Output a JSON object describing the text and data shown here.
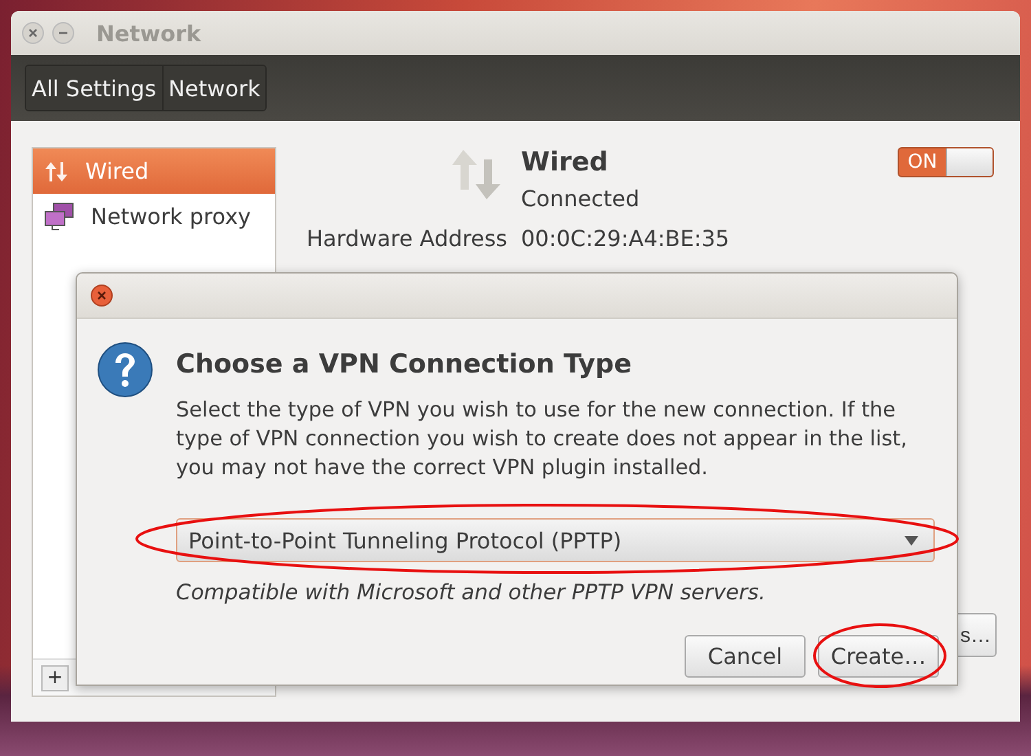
{
  "window": {
    "title": "Network"
  },
  "breadcrumbs": [
    {
      "label": "All Settings"
    },
    {
      "label": "Network"
    }
  ],
  "sidebar": {
    "items": [
      {
        "label": "Wired",
        "kind": "wired",
        "selected": true
      },
      {
        "label": "Network proxy",
        "kind": "proxy",
        "selected": false
      }
    ],
    "buttons": [
      "+"
    ]
  },
  "device": {
    "name": "Wired",
    "status": "Connected",
    "switch": {
      "label": "ON",
      "on": true
    },
    "details": [
      {
        "label": "Hardware Address",
        "value": "00:0C:29:A4:BE:35"
      }
    ],
    "partial_button": "s…"
  },
  "dialog": {
    "title": "Choose a VPN Connection Type",
    "message": "Select the type of VPN you wish to use for the new connection.  If the type of VPN connection you wish to create does not appear in the list, you may not have the correct VPN plugin installed.",
    "combo": {
      "value": "Point-to-Point Tunneling Protocol (PPTP)",
      "highlighted": true
    },
    "description": "Compatible with Microsoft and other PPTP VPN servers.",
    "buttons": [
      {
        "label": "Cancel",
        "highlighted": false
      },
      {
        "label": "Create…",
        "highlighted": true
      }
    ]
  }
}
